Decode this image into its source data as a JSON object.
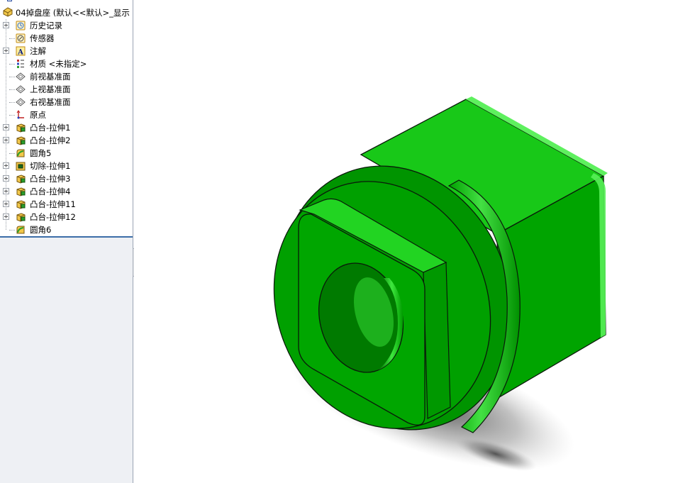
{
  "tree": {
    "root_label": "04掉盘座 (默认<<默认>_显示",
    "items": [
      {
        "label": "历史记录",
        "icon": "history-icon",
        "expandable": true
      },
      {
        "label": "传感器",
        "icon": "sensor-icon",
        "expandable": false
      },
      {
        "label": "注解",
        "icon": "annotation-icon",
        "expandable": true
      },
      {
        "label": "材质 <未指定>",
        "icon": "material-icon",
        "expandable": false
      },
      {
        "label": "前视基准面",
        "icon": "plane-icon",
        "expandable": false
      },
      {
        "label": "上视基准面",
        "icon": "plane-icon",
        "expandable": false
      },
      {
        "label": "右视基准面",
        "icon": "plane-icon",
        "expandable": false
      },
      {
        "label": "原点",
        "icon": "origin-icon",
        "expandable": false
      },
      {
        "label": "凸台-拉伸1",
        "icon": "boss-extrude-icon",
        "expandable": true
      },
      {
        "label": "凸台-拉伸2",
        "icon": "boss-extrude-icon",
        "expandable": true
      },
      {
        "label": "圆角5",
        "icon": "fillet-icon",
        "expandable": false
      },
      {
        "label": "切除-拉伸1",
        "icon": "cut-extrude-icon",
        "expandable": true
      },
      {
        "label": "凸台-拉伸3",
        "icon": "boss-extrude-icon",
        "expandable": true
      },
      {
        "label": "凸台-拉伸4",
        "icon": "boss-extrude-icon",
        "expandable": true
      },
      {
        "label": "凸台-拉伸11",
        "icon": "boss-extrude-icon",
        "expandable": true
      },
      {
        "label": "凸台-拉伸12",
        "icon": "boss-extrude-icon",
        "expandable": true
      },
      {
        "label": "圆角6",
        "icon": "fillet-icon",
        "expandable": false
      }
    ]
  },
  "colors": {
    "part_green": "#00a800",
    "part_dark": "#007a00",
    "part_light": "#22d022",
    "edge": "#0a1a0a",
    "panel_bg": "#eef0f4",
    "accent": "#3c6ea8"
  }
}
